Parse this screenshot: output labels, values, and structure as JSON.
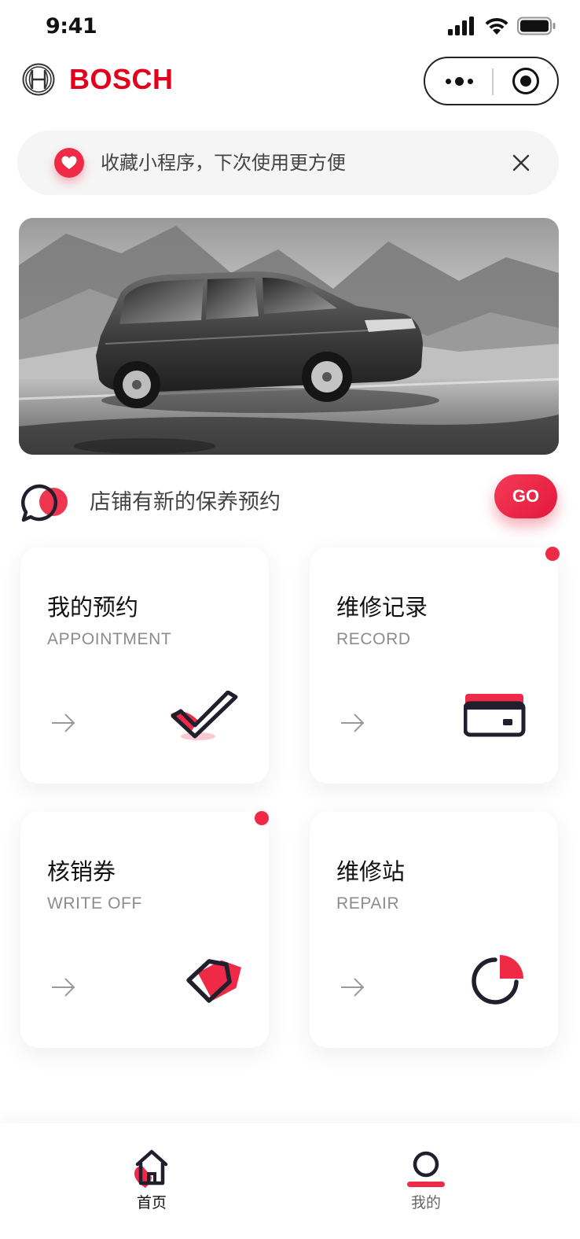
{
  "status_bar": {
    "time": "9:41",
    "icons": [
      "signal-icon",
      "wifi-icon",
      "battery-icon"
    ]
  },
  "header": {
    "brand_name": "BOSCH",
    "logo_icon": "bosch-armature-icon",
    "capsule": {
      "more_icon": "more-dots-icon",
      "close_icon": "close-miniprogram-icon"
    }
  },
  "notice": {
    "icon": "heart-icon",
    "text": "收藏小程序，下次使用更方便",
    "close_icon": "close-icon"
  },
  "banner": {
    "image": "car-banner-mpv"
  },
  "message": {
    "icon": "chat-bubble-icon",
    "text": "店铺有新的保养预约",
    "button_label": "GO"
  },
  "cards": [
    {
      "title": "我的预约",
      "subtitle": "APPOINTMENT",
      "icon": "check-icon",
      "has_badge": false
    },
    {
      "title": "维修记录",
      "subtitle": "RECORD",
      "icon": "card-icon",
      "has_badge": true
    },
    {
      "title": "核销券",
      "subtitle": "WRITE OFF",
      "icon": "tag-icon",
      "has_badge": true
    },
    {
      "title": "维修站",
      "subtitle": "REPAIR",
      "icon": "pie-chart-icon",
      "has_badge": false
    }
  ],
  "tabbar": {
    "items": [
      {
        "label": "首页",
        "icon": "home-icon",
        "active": true
      },
      {
        "label": "我的",
        "icon": "user-icon",
        "active": false
      }
    ]
  },
  "colors": {
    "accent": "#ee2a47",
    "brand": "#e2001a",
    "dark": "#1f1f2e",
    "muted": "#8c8c8c"
  }
}
